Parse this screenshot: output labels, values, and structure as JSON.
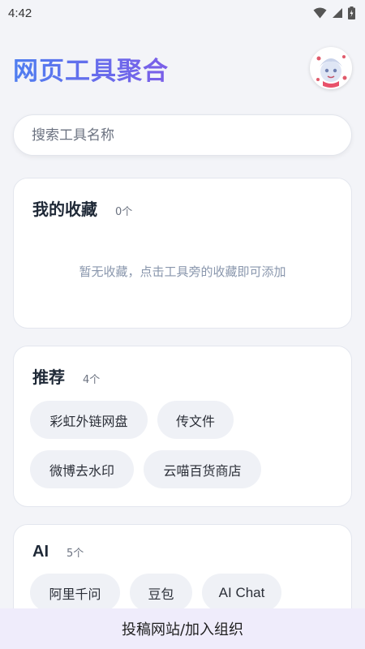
{
  "status_bar": {
    "time": "4:42"
  },
  "header": {
    "title": "网页工具聚合"
  },
  "search": {
    "placeholder": "搜索工具名称"
  },
  "favorites": {
    "title": "我的收藏",
    "count": "0个",
    "empty_text": "暂无收藏，点击工具旁的收藏即可添加"
  },
  "recommended": {
    "title": "推荐",
    "count": "4个",
    "items": [
      "彩虹外链网盘",
      "传文件",
      "微博去水印",
      "云喵百货商店"
    ]
  },
  "ai": {
    "title": "AI",
    "count": "5个",
    "items": [
      "阿里千问",
      "豆包",
      "AI Chat"
    ]
  },
  "bottom_bar": {
    "label": "投稿网站/加入组织"
  },
  "colors": {
    "title_gradient_start": "#4f7ef0",
    "title_gradient_end": "#7b5ee8",
    "bottom_bar_bg": "#efecfb"
  }
}
